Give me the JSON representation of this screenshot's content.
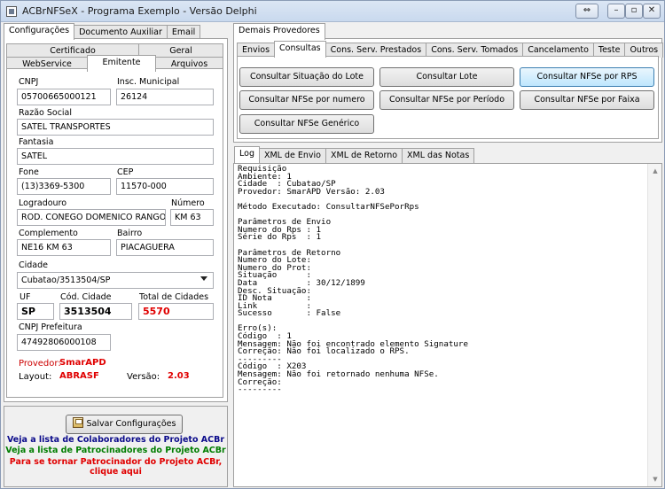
{
  "window": {
    "title": "ACBrNFSeX - Programa Exemplo - Versão Delphi"
  },
  "left_tabs": [
    {
      "label": "Configurações",
      "active": true
    },
    {
      "label": "Documento Auxiliar",
      "active": false
    },
    {
      "label": "Email",
      "active": false
    }
  ],
  "config_tabs_row1": [
    {
      "label": "Certificado"
    },
    {
      "label": "Geral"
    }
  ],
  "config_tabs_row2": [
    {
      "label": "WebService",
      "active": false
    },
    {
      "label": "Emitente",
      "active": true
    },
    {
      "label": "Arquivos",
      "active": false
    }
  ],
  "emitente": {
    "cnpj_label": "CNPJ",
    "cnpj": "05700665000121",
    "insc_mun_label": "Insc. Municipal",
    "insc_mun": "26124",
    "razao_label": "Razão Social",
    "razao": "SATEL TRANSPORTES",
    "fantasia_label": "Fantasia",
    "fantasia": "SATEL",
    "fone_label": "Fone",
    "fone": "(13)3369-5300",
    "cep_label": "CEP",
    "cep": "11570-000",
    "logradouro_label": "Logradouro",
    "logradouro": "ROD. CONEGO DOMENICO RANGONI",
    "numero_label": "Número",
    "numero": "KM 63",
    "complemento_label": "Complemento",
    "complemento": "NE16 KM 63",
    "bairro_label": "Bairro",
    "bairro": "PIACAGUERA",
    "cidade_label": "Cidade",
    "cidade": "Cubatao/3513504/SP",
    "uf_label": "UF",
    "uf": "SP",
    "cod_cidade_label": "Cód. Cidade",
    "cod_cidade": "3513504",
    "total_cidades_label": "Total de Cidades",
    "total_cidades": "5570",
    "cnpj_pref_label": "CNPJ Prefeitura",
    "cnpj_pref": "47492806000108",
    "provedor_label": "Provedor:",
    "provedor": "SmarAPD",
    "layout_label": "Layout:",
    "layout": "ABRASF",
    "versao_label": "Versão:",
    "versao": "2.03"
  },
  "bottom_left": {
    "save_label": "Salvar Configurações",
    "link1": "Veja a lista de Colaboradores do Projeto ACBr",
    "link2": "Veja a lista de Patrocinadores do Projeto ACBr",
    "link3a": "Para se tornar Patrocinador do Projeto ACBr,",
    "link3b": "clique aqui"
  },
  "right_top": {
    "provider_tab": "Demais Provedores",
    "tabs": [
      {
        "label": "Envios",
        "active": false
      },
      {
        "label": "Consultas",
        "active": true
      },
      {
        "label": "Cons. Serv. Prestados",
        "active": false
      },
      {
        "label": "Cons. Serv. Tomados",
        "active": false
      },
      {
        "label": "Cancelamento",
        "active": false
      },
      {
        "label": "Teste",
        "active": false
      },
      {
        "label": "Outros",
        "active": false
      }
    ],
    "buttons": {
      "consultar_situacao": "Consultar Situação do Lote",
      "consultar_lote": "Consultar Lote",
      "consultar_nfse_rps": "Consultar NFSe por RPS",
      "consultar_nfse_numero": "Consultar NFSe por numero",
      "consultar_nfse_periodo": "Consultar NFSe por Período",
      "consultar_nfse_faixa": "Consultar NFSe por Faixa",
      "consultar_nfse_generico": "Consultar NFSe Genérico"
    }
  },
  "log_tabs": [
    {
      "label": "Log",
      "active": true
    },
    {
      "label": "XML de Envio",
      "active": false
    },
    {
      "label": "XML de Retorno",
      "active": false
    },
    {
      "label": "XML das Notas",
      "active": false
    }
  ],
  "log": {
    "text": "Requisição\nAmbiente: 1\nCidade  : Cubatao/SP\nProvedor: SmarAPD Versão: 2.03\n\nMétodo Executado: ConsultarNFSePorRps\n\nParâmetros de Envio\nNumero do Rps : 1\nSérie do Rps  : 1\n\nParâmetros de Retorno\nNumero do Lote:\nNumero do Prot:\nSituação      :\nData          : 30/12/1899\nDesc. Situação:\nID Nota       :\nLink          :\nSucesso       : False\n\nErro(s):\nCódigo  : 1\nMensagem: Não foi encontrado elemento Signature\nCorreção: Não foi localizado o RPS.\n---------\nCódigo  : X203\nMensagem: Não foi retornado nenhuma NFSe.\nCorreção:\n---------"
  }
}
